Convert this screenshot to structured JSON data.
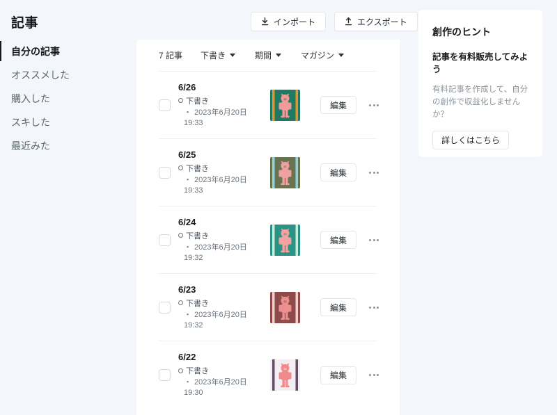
{
  "header": {
    "title": "記事",
    "import_label": "インポート",
    "export_label": "エクスポート",
    "import_icon": "download-arrow-icon",
    "export_icon": "upload-arrow-icon"
  },
  "sidebar": {
    "items": [
      {
        "label": "自分の記事",
        "active": true
      },
      {
        "label": "オススメした",
        "active": false
      },
      {
        "label": "購入した",
        "active": false
      },
      {
        "label": "スキした",
        "active": false
      },
      {
        "label": "最近みた",
        "active": false
      }
    ]
  },
  "filters": {
    "count_label": "7 記事",
    "dropdowns": [
      {
        "label": "下書き"
      },
      {
        "label": "期間"
      },
      {
        "label": "マガジン"
      }
    ]
  },
  "list": {
    "edit_label": "編集",
    "more_label": "…",
    "rows": [
      {
        "title": "6/26",
        "status": "下書き",
        "date": "2023年6月20日",
        "time": "19:33",
        "separator": "・",
        "thumb": {
          "bg": "#1f7a63",
          "bar": "#e8922a",
          "body": "#f29a9a"
        }
      },
      {
        "title": "6/25",
        "status": "下書き",
        "date": "2023年6月20日",
        "time": "19:33",
        "separator": "・",
        "thumb": {
          "bg": "#6a7350",
          "bar": "#8fd4dd",
          "body": "#f0a0a0"
        }
      },
      {
        "title": "6/24",
        "status": "下書き",
        "date": "2023年6月20日",
        "time": "19:32",
        "separator": "・",
        "thumb": {
          "bg": "#2a9385",
          "bar": "#cfe9d8",
          "body": "#f3a2a2"
        }
      },
      {
        "title": "6/23",
        "status": "下書き",
        "date": "2023年6月20日",
        "time": "19:32",
        "separator": "・",
        "thumb": {
          "bg": "#8e4a4a",
          "bar": "#f0cfcf",
          "body": "#eb8f8f"
        }
      },
      {
        "title": "6/22",
        "status": "下書き",
        "date": "2023年6月20日",
        "time": "19:30",
        "separator": "・",
        "thumb": {
          "bg": "#f2eef2",
          "bar": "#6b4a6b",
          "body": "#f08a8a"
        }
      }
    ]
  },
  "tips": {
    "heading": "創作のヒント",
    "subheading": "記事を有料販売してみよう",
    "body": "有料記事を作成して、自分の創作で収益化しませんか？",
    "button_label": "詳しくはこちら"
  },
  "colors": {
    "page_bg": "#f3f6fa",
    "card_bg": "#ffffff",
    "text": "#16191c",
    "muted": "#8b949b",
    "border": "#e4e8ec"
  }
}
